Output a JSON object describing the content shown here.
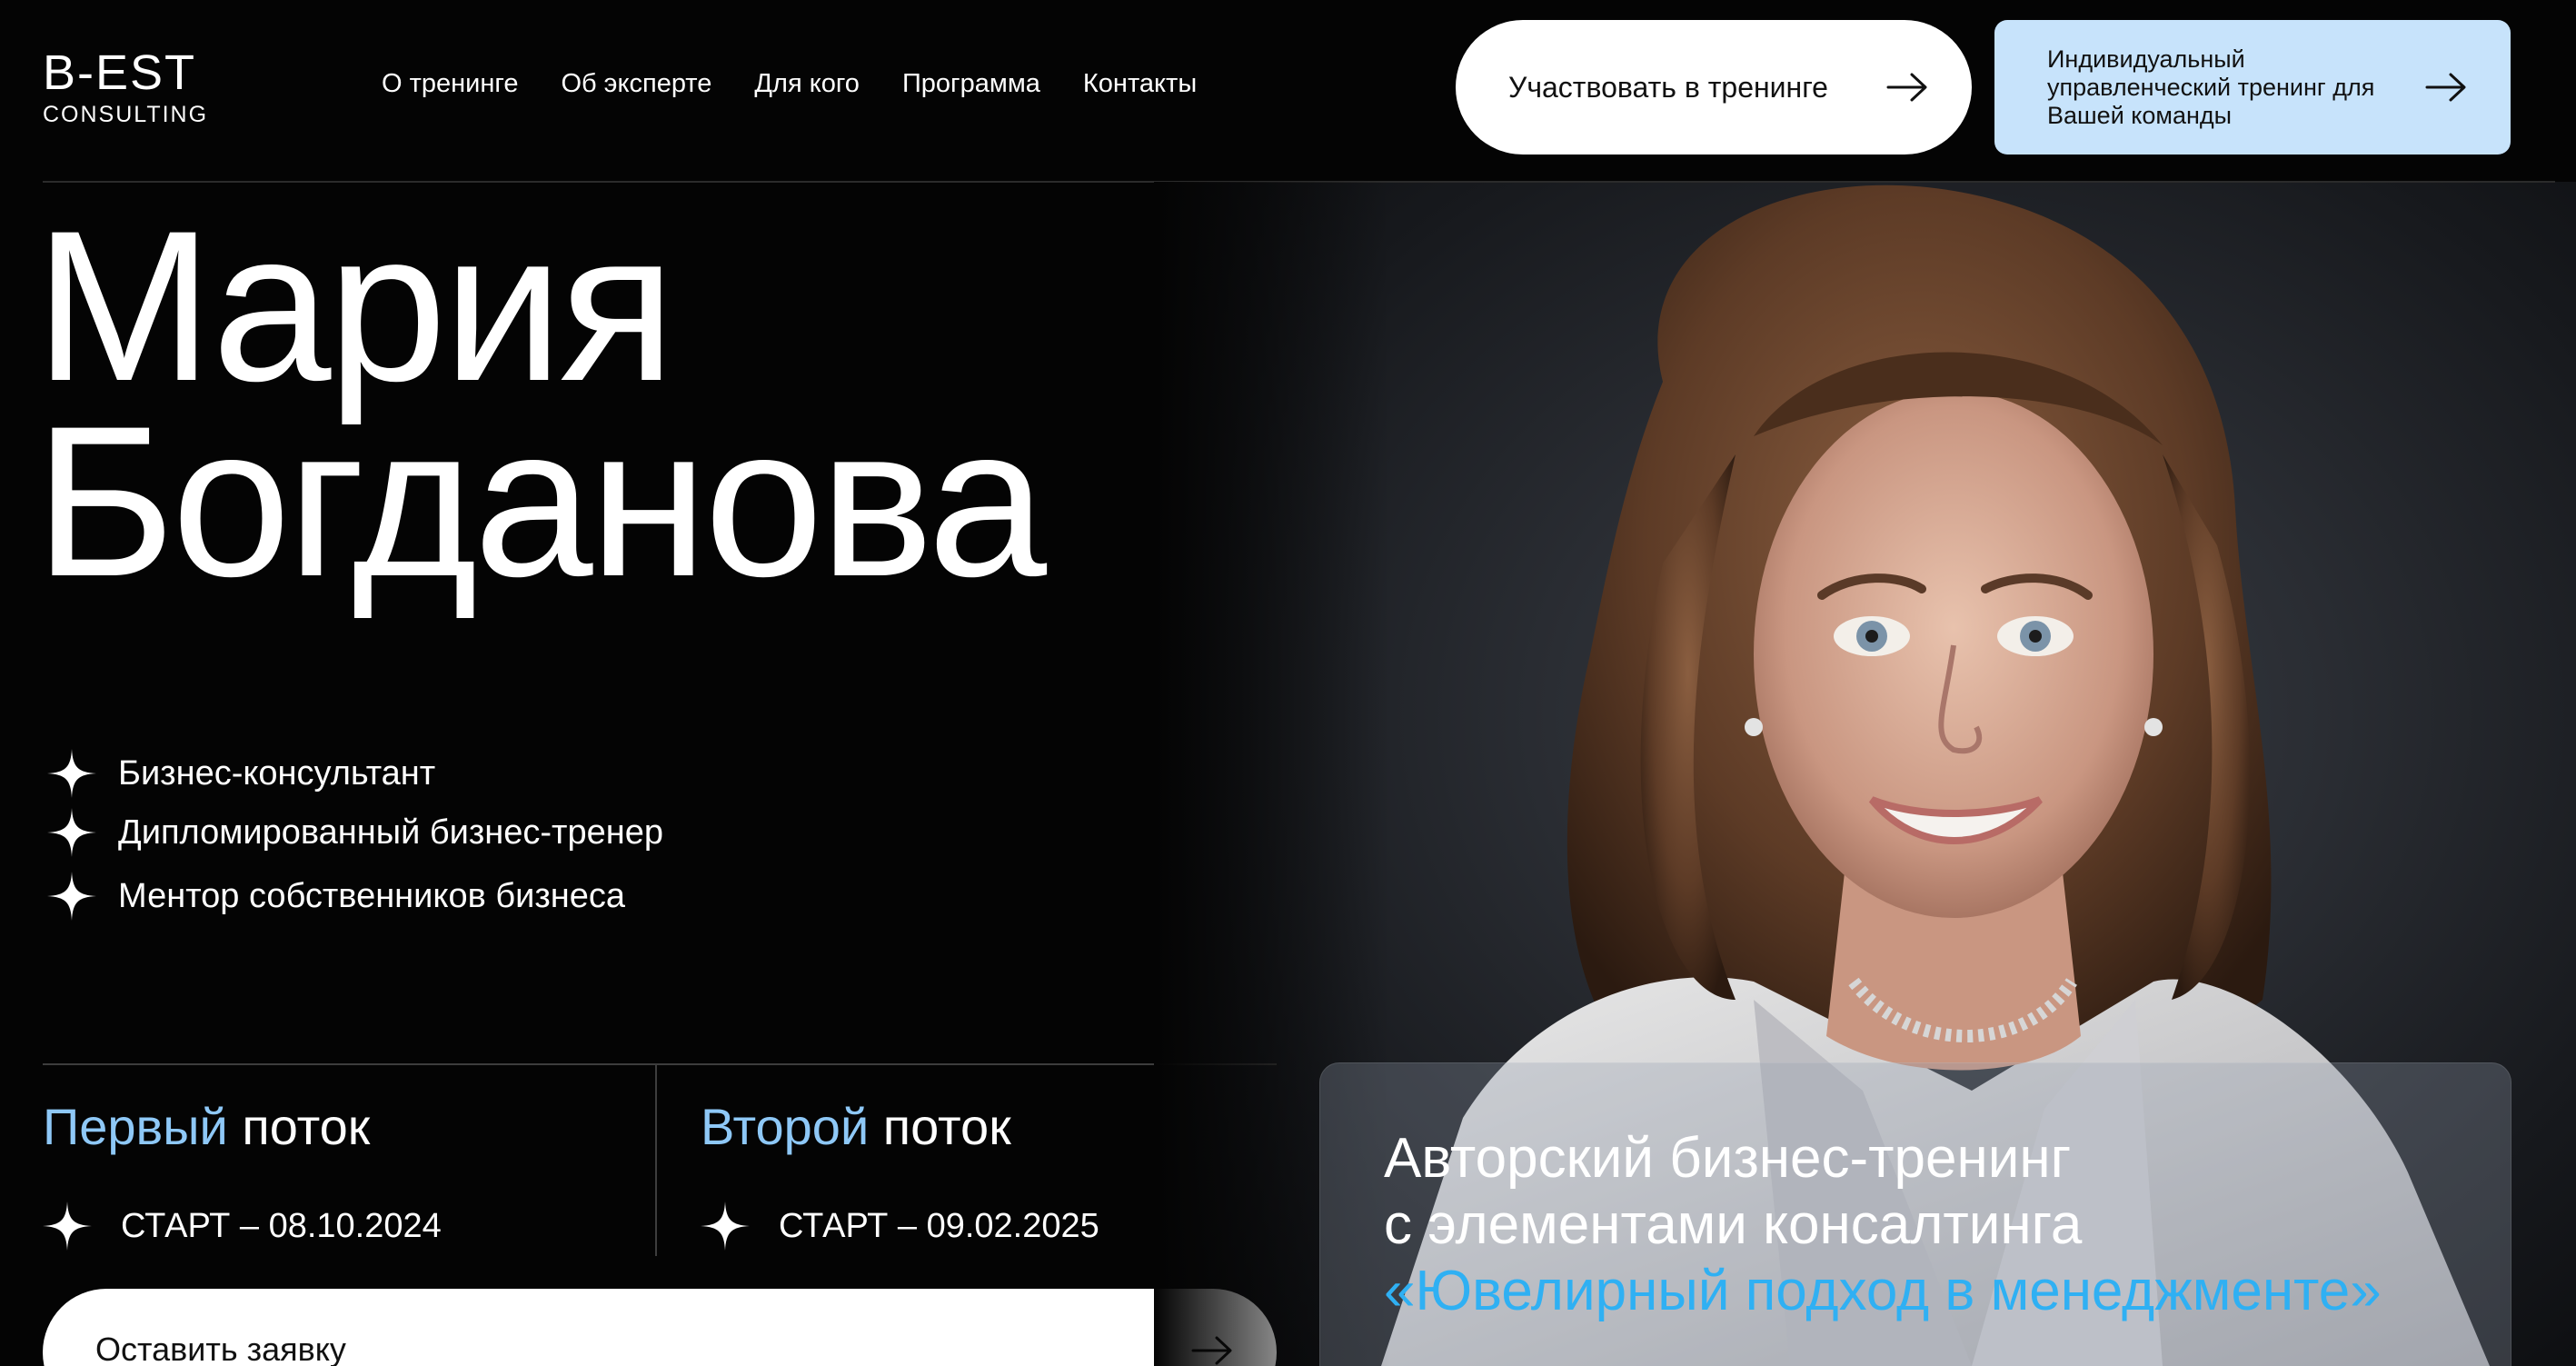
{
  "header": {
    "logo_main": "B-EST",
    "logo_sub": "CONSULTING",
    "nav": [
      "О тренинге",
      "Об эксперте",
      "Для кого",
      "Программа",
      "Контакты"
    ],
    "participate_label": "Участвовать в тренинге",
    "team_label": "Индивидуальный управленческий тренинг для Вашей команды"
  },
  "hero": {
    "first_name": "Мария",
    "last_name": "Богданова",
    "roles": [
      "Бизнес-консультант",
      "Дипломированный бизнес-тренер",
      "Ментор собственников бизнеса"
    ]
  },
  "streams": [
    {
      "accent": "Первый",
      "rest": " поток",
      "date": "СТАРТ – 08.10.2024"
    },
    {
      "accent": "Второй",
      "rest": " поток",
      "date": "СТАРТ – 09.02.2025"
    }
  ],
  "apply_label": "Оставить заявку",
  "card": {
    "line1": "Авторский бизнес-тренинг",
    "line2": "с элементами консалтинга",
    "accent": "«Ювелирный подход в менеджменте»"
  },
  "colors": {
    "background": "#040404",
    "accent_light_blue": "#8ec8f7",
    "accent_bright_blue": "#2fb0f3",
    "team_button_bg": "#c7e3fb"
  },
  "icons": [
    "sparkle-icon",
    "arrow-right-icon"
  ]
}
